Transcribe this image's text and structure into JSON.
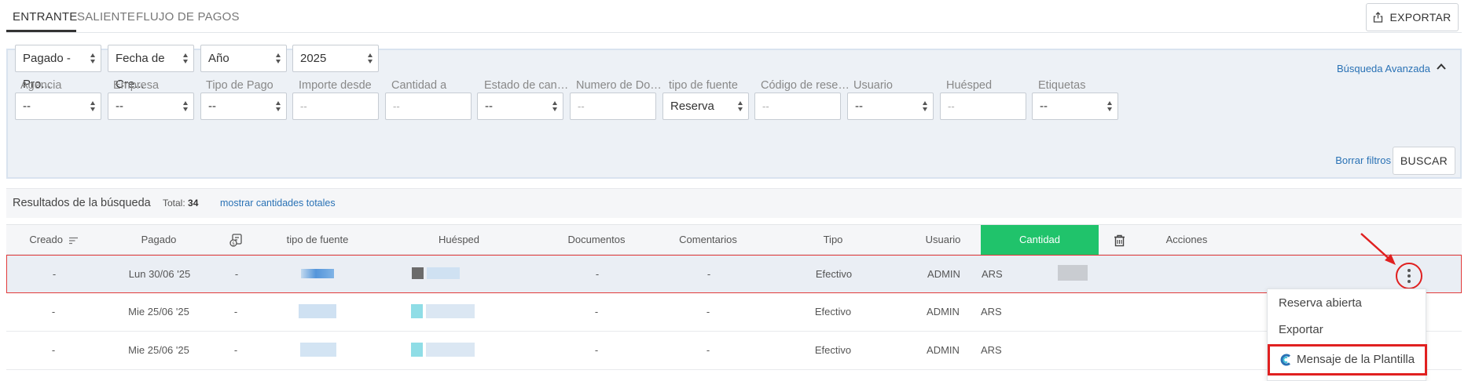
{
  "tabs": [
    {
      "label": "ENTRANTE",
      "active": true
    },
    {
      "label": "SALIENTE",
      "active": false
    },
    {
      "label": "FLUJO DE PAGOS",
      "active": false
    }
  ],
  "export_button": {
    "label": "EXPORTAR",
    "icon": "share-export-icon"
  },
  "filters": {
    "top_selects": [
      {
        "value": "Pagado - Pro..."
      },
      {
        "value": "Fecha de Cre..."
      },
      {
        "value": "Año"
      },
      {
        "value": "2025"
      }
    ],
    "advanced_link": "Búsqueda Avanzada",
    "fields": [
      {
        "label": "Agencia",
        "kind": "select",
        "value": "--"
      },
      {
        "label": "Empresa",
        "kind": "select",
        "value": "--"
      },
      {
        "label": "Tipo de Pago",
        "kind": "select",
        "value": "--"
      },
      {
        "label": "Importe desde",
        "kind": "input",
        "placeholder": "--"
      },
      {
        "label": "Cantidad a",
        "kind": "input",
        "placeholder": "--"
      },
      {
        "label": "Estado de cancela...",
        "kind": "select",
        "value": "--"
      },
      {
        "label": "Numero de Docu...",
        "kind": "input",
        "placeholder": "--"
      },
      {
        "label": "tipo de fuente",
        "kind": "select",
        "value": "Reserva"
      },
      {
        "label": "Código de reserva...",
        "kind": "input",
        "placeholder": "--"
      },
      {
        "label": "Usuario",
        "kind": "select",
        "value": "--"
      },
      {
        "label": "Huésped",
        "kind": "input",
        "placeholder": "--"
      },
      {
        "label": "Etiquetas",
        "kind": "select",
        "value": "--"
      }
    ],
    "clear_link": "Borrar filtros",
    "search_button": "BUSCAR"
  },
  "results": {
    "title": "Resultados de la búsqueda",
    "total_label": "Total:",
    "total_value": "34",
    "show_totals_link": "mostrar cantidades totales"
  },
  "table": {
    "columns": {
      "created": "Creado",
      "paid": "Pagado",
      "source_type": "tipo de fuente",
      "guest": "Huésped",
      "documents": "Documentos",
      "comments": "Comentarios",
      "type": "Tipo",
      "user": "Usuario",
      "amount": "Cantidad",
      "actions": "Acciones"
    },
    "rows": [
      {
        "created": "-",
        "paid": "Lun 30/06 '25",
        "col3": "-",
        "documents": "-",
        "comments": "-",
        "type": "Efectivo",
        "user": "ADMIN",
        "currency": "ARS"
      },
      {
        "created": "-",
        "paid": "Mie 25/06 '25",
        "col3": "-",
        "documents": "-",
        "comments": "-",
        "type": "Efectivo",
        "user": "ADMIN",
        "currency": "ARS"
      },
      {
        "created": "-",
        "paid": "Mie 25/06 '25",
        "col3": "-",
        "documents": "-",
        "comments": "-",
        "type": "Efectivo",
        "user": "ADMIN",
        "currency": "ARS"
      }
    ]
  },
  "actions_menu": {
    "items": [
      "Reserva abierta",
      "Exportar",
      "Mensaje de la Plantilla"
    ]
  },
  "colors": {
    "accent_link": "#2a72b5",
    "amount_header": "#20c36b",
    "highlight": "#e02020"
  }
}
